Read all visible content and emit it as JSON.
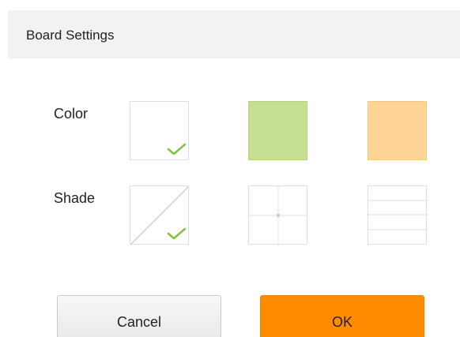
{
  "header": {
    "title": "Board Settings"
  },
  "rows": {
    "color_label": "Color",
    "shade_label": "Shade"
  },
  "colors": {
    "white": "#ffffff",
    "green": "#c6df93",
    "green_border": "#b5d47b",
    "orange": "#ffd497",
    "orange_border": "#fbc77c",
    "check": "#7cc43e",
    "ok_button": "#ff8c00"
  },
  "color_options": [
    {
      "name": "white",
      "selected": true
    },
    {
      "name": "green",
      "selected": false
    },
    {
      "name": "orange",
      "selected": false
    }
  ],
  "shade_options": [
    {
      "name": "diagonal",
      "selected": true
    },
    {
      "name": "crosshair",
      "selected": false
    },
    {
      "name": "horizontal-lines",
      "selected": false
    }
  ],
  "buttons": {
    "cancel_label": "Cancel",
    "ok_label": "OK"
  },
  "icons": {
    "selected": "checkmark-icon"
  }
}
